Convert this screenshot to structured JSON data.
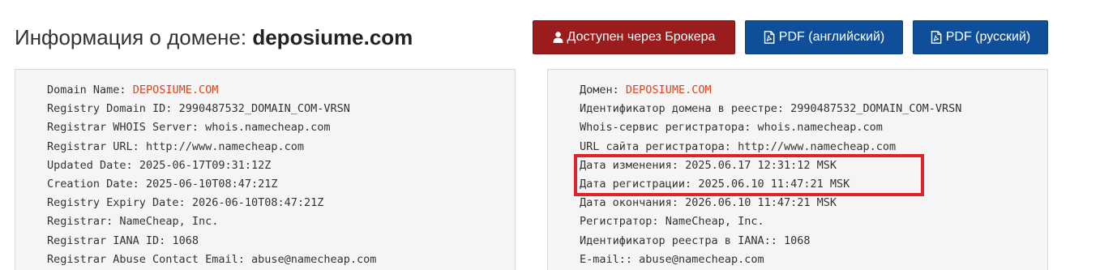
{
  "header": {
    "title_prefix": "Информация о домене:",
    "title_domain": "deposiume.com"
  },
  "buttons": {
    "broker_label": "Доступен через Брокера",
    "pdf_en_label": "PDF (английский)",
    "pdf_ru_label": "PDF (русский)"
  },
  "whois_en": {
    "lines": [
      {
        "key": "Domain Name:",
        "value": "DEPOSIUME.COM"
      },
      {
        "key": "Registry Domain ID:",
        "value": "2990487532_DOMAIN_COM-VRSN"
      },
      {
        "key": "Registrar WHOIS Server:",
        "value": "whois.namecheap.com"
      },
      {
        "key": "Registrar URL:",
        "value": "http://www.namecheap.com"
      },
      {
        "key": "Updated Date:",
        "value": "2025-06-17T09:31:12Z"
      },
      {
        "key": "Creation Date:",
        "value": "2025-06-10T08:47:21Z"
      },
      {
        "key": "Registry Expiry Date:",
        "value": "2026-06-10T08:47:21Z"
      },
      {
        "key": "Registrar:",
        "value": "NameCheap, Inc."
      },
      {
        "key": "Registrar IANA ID:",
        "value": "1068"
      },
      {
        "key": "Registrar Abuse Contact Email:",
        "value": "abuse@namecheap.com"
      }
    ]
  },
  "whois_ru": {
    "lines": [
      {
        "key": "Домен:",
        "value": "DEPOSIUME.COM"
      },
      {
        "key": "Идентификатор домена в реестре:",
        "value": "2990487532_DOMAIN_COM-VRSN"
      },
      {
        "key": "Whois-сервис регистратора:",
        "value": "whois.namecheap.com"
      },
      {
        "key": "URL сайта регистратора:",
        "value": "http://www.namecheap.com"
      },
      {
        "key": "Дата изменения:",
        "value": "2025.06.17 12:31:12 MSK"
      },
      {
        "key": "Дата регистрации:",
        "value": "2025.06.10 11:47:21 MSK"
      },
      {
        "key": "Дата окончания:",
        "value": "2026.06.10 11:47:21 MSK"
      },
      {
        "key": "Регистратор:",
        "value": "NameCheap, Inc."
      },
      {
        "key": "Идентификатор реестра в IANA::",
        "value": "1068"
      },
      {
        "key": "E-mail::",
        "value": "abuse@namecheap.com"
      }
    ]
  },
  "colors": {
    "broker_button": "#9b1c1c",
    "pdf_button": "#0f4f99",
    "domain_value": "#e0441c",
    "highlight": "#e0232a"
  },
  "icons": {
    "broker": "user-icon",
    "pdf": "file-pdf-icon"
  }
}
